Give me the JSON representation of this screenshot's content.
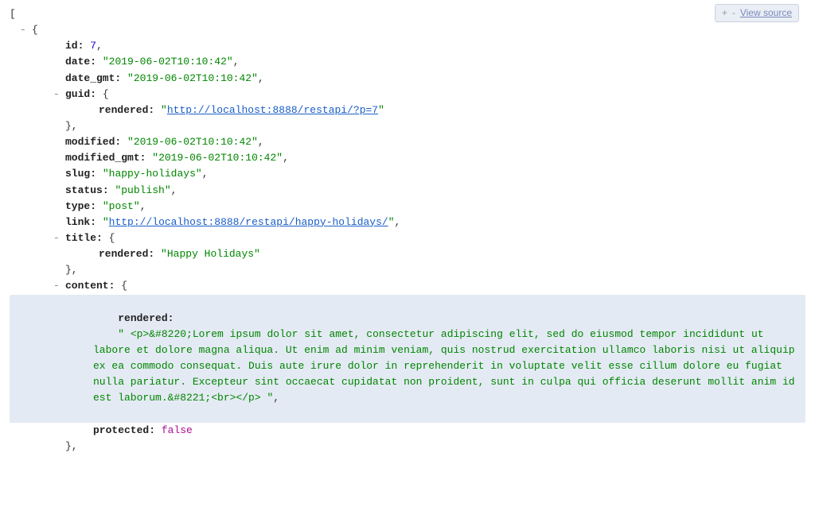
{
  "toolbar": {
    "plus": "+",
    "minus": "-",
    "view_source": "View source"
  },
  "syntax": {
    "open_bracket": "[",
    "open_brace": "{",
    "close_brace": "}",
    "close_brace_comma": "},",
    "collapse": "-",
    "colon": ":",
    "comma": ",",
    "open_brace_inline": " {",
    "quote": "\""
  },
  "keys": {
    "id": "id",
    "date": "date",
    "date_gmt": "date_gmt",
    "guid": "guid",
    "rendered": "rendered",
    "modified": "modified",
    "modified_gmt": "modified_gmt",
    "slug": "slug",
    "status": "status",
    "type": "type",
    "link": "link",
    "title": "title",
    "content": "content",
    "protected": "protected"
  },
  "values": {
    "id": "7",
    "date": "2019-06-02T10:10:42",
    "date_gmt": "2019-06-02T10:10:42",
    "guid_rendered": "http://localhost:8888/restapi/?p=7",
    "modified": "2019-06-02T10:10:42",
    "modified_gmt": "2019-06-02T10:10:42",
    "slug": "happy-holidays",
    "status": "publish",
    "type": "post",
    "link": "http://localhost:8888/restapi/happy-holidays/",
    "title_rendered": "Happy Holidays",
    "content_rendered": " <p>&#8220;Lorem ipsum dolor sit amet, consectetur adipiscing elit, sed do eiusmod tempor incididunt ut labore et dolore magna aliqua. Ut enim ad minim veniam, quis nostrud exercitation ullamco laboris nisi ut aliquip ex ea commodo consequat. Duis aute irure dolor in reprehenderit in voluptate velit esse cillum dolore eu fugiat nulla pariatur. Excepteur sint occaecat cupidatat non proident, sunt in culpa qui officia deserunt mollit anim id est laborum.&#8221;<br></p> ",
    "protected": "false"
  }
}
